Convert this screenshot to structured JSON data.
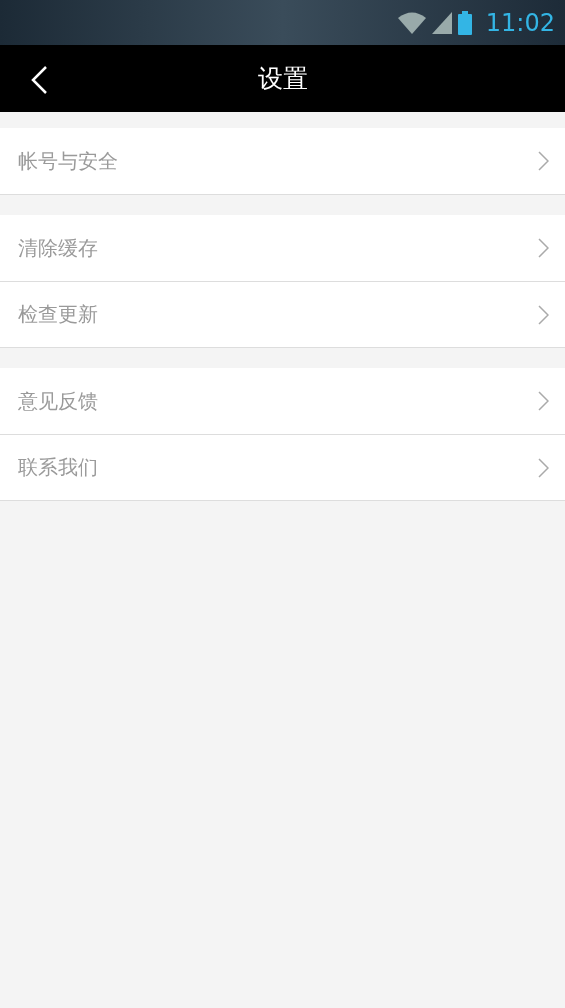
{
  "status_bar": {
    "time": "11:02"
  },
  "header": {
    "title": "设置"
  },
  "groups": [
    {
      "items": [
        {
          "label": "帐号与安全"
        }
      ]
    },
    {
      "items": [
        {
          "label": "清除缓存"
        },
        {
          "label": "检查更新"
        }
      ]
    },
    {
      "items": [
        {
          "label": "意见反馈"
        },
        {
          "label": "联系我们"
        }
      ]
    }
  ]
}
